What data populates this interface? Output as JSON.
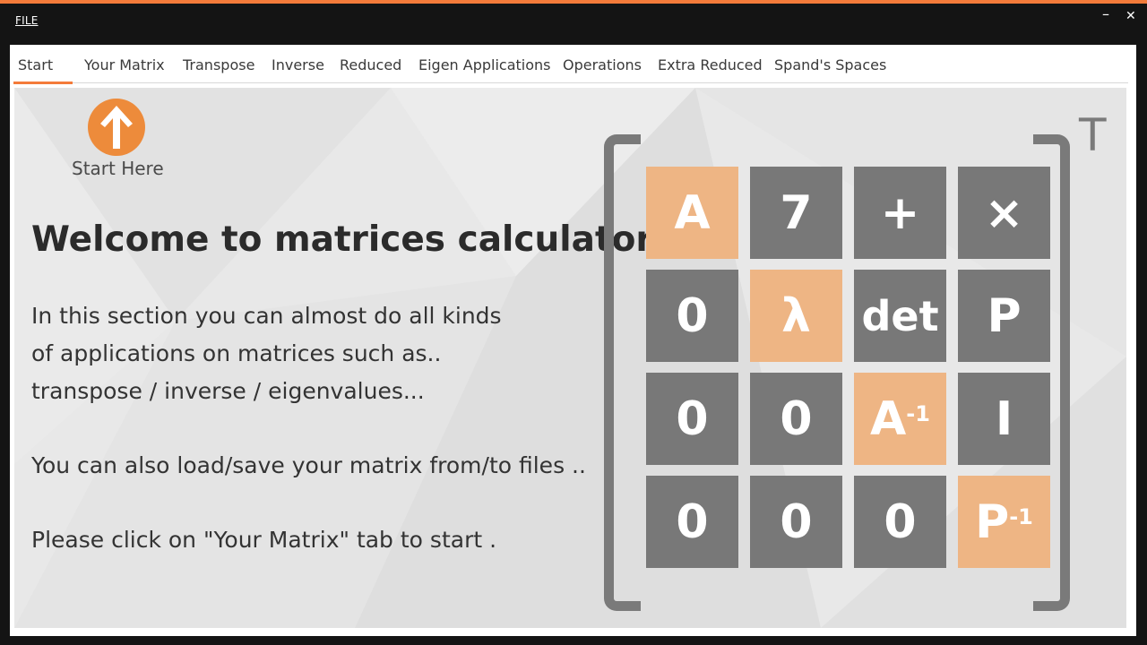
{
  "titlebar": {
    "file_menu_label": "FILE",
    "minimize_glyph": "–",
    "close_glyph": "✕"
  },
  "tabs": [
    {
      "label": "Start",
      "active": true
    },
    {
      "label": "Your Matrix"
    },
    {
      "label": "Transpose"
    },
    {
      "label": "Inverse"
    },
    {
      "label": "Reduced"
    },
    {
      "label": "Eigen Applications"
    },
    {
      "label": "Operations"
    },
    {
      "label": "Extra Reduced"
    },
    {
      "label": "Spand's Spaces"
    }
  ],
  "start_panel": {
    "start_here_label": "Start Here",
    "start_icon": "arrow-up-icon",
    "heading": "Welcome to matrices calculator",
    "paragraph_lines": [
      "In this section you can almost do all kinds",
      "of applications on matrices such as..",
      "transpose / inverse / eigenvalues...",
      "You can also load/save your matrix from/to files ..",
      "Please click on \"Your Matrix\" tab to start ."
    ]
  },
  "matrix_graphic": {
    "transpose_symbol": "T",
    "cells": [
      {
        "text": "A",
        "sup": "",
        "highlight": true
      },
      {
        "text": "7",
        "sup": "",
        "highlight": false
      },
      {
        "text": "+",
        "sup": "",
        "highlight": false
      },
      {
        "text": "×",
        "sup": "",
        "highlight": false
      },
      {
        "text": "0",
        "sup": "",
        "highlight": false
      },
      {
        "text": "λ",
        "sup": "",
        "highlight": true
      },
      {
        "text": "det",
        "sup": "",
        "highlight": false
      },
      {
        "text": "P",
        "sup": "",
        "highlight": false
      },
      {
        "text": "0",
        "sup": "",
        "highlight": false
      },
      {
        "text": "0",
        "sup": "",
        "highlight": false
      },
      {
        "text": "A",
        "sup": "-1",
        "highlight": true
      },
      {
        "text": "I",
        "sup": "",
        "highlight": false
      },
      {
        "text": "0",
        "sup": "",
        "highlight": false
      },
      {
        "text": "0",
        "sup": "",
        "highlight": false
      },
      {
        "text": "0",
        "sup": "",
        "highlight": false
      },
      {
        "text": "P",
        "sup": "-1",
        "highlight": true
      }
    ]
  },
  "colors": {
    "accent": "#f47b3a",
    "cell_gray": "#787878",
    "cell_orange": "#eeb584",
    "bracket": "#7a7a7a"
  }
}
